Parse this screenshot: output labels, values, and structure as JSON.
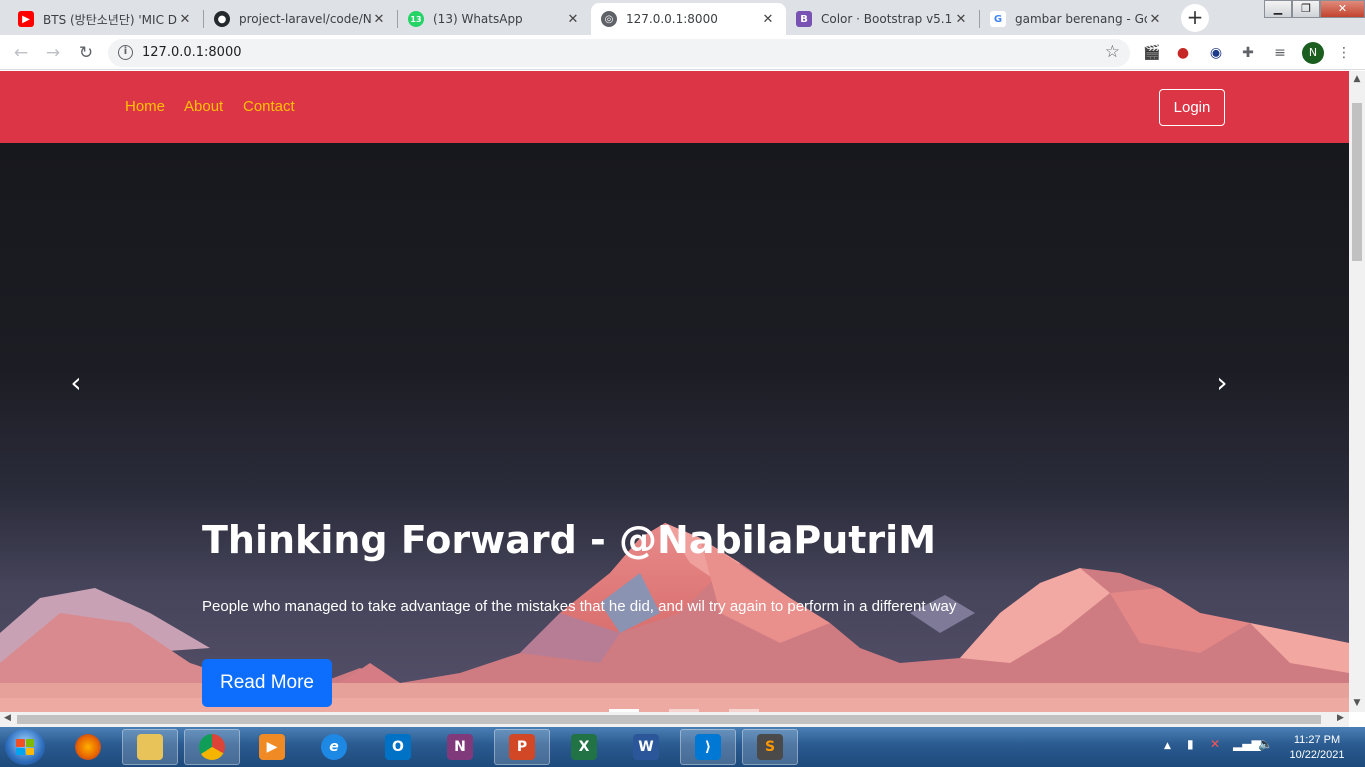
{
  "browser": {
    "tabs": [
      {
        "title": "BTS (방탄소년단) 'MIC D",
        "icon": "youtube-icon",
        "color": "#ff0000"
      },
      {
        "title": "project-laravel/code/Nal",
        "icon": "github-icon",
        "color": "#24292e"
      },
      {
        "title": "(13) WhatsApp",
        "icon": "whatsapp-icon",
        "color": "#25d366",
        "badge": "13"
      },
      {
        "title": "127.0.0.1:8000",
        "icon": "globe-icon",
        "color": "#5f6368",
        "active": true
      },
      {
        "title": "Color · Bootstrap v5.1",
        "icon": "bootstrap-icon",
        "color": "#7952b3",
        "letter": "B"
      },
      {
        "title": "gambar berenang - Goo",
        "icon": "google-icon",
        "color": "#4285f4",
        "letter": "G"
      }
    ],
    "new_tab": "+",
    "url": "127.0.0.1:8000",
    "profile_initial": "N"
  },
  "navbar": {
    "links": [
      "Home",
      "About",
      "Contact"
    ],
    "login_label": "Login",
    "bg_color": "#dc3545",
    "link_color": "#ffc107"
  },
  "carousel": {
    "title": "Thinking Forward - @NabilaPutriM",
    "text": "People who managed to take advantage of the mistakes that he did, and wil try again to perform in a different way",
    "button_label": "Read More",
    "prev_glyph": "‹",
    "next_glyph": "›",
    "slide_count": 3,
    "active_slide": 1
  },
  "taskbar": {
    "apps": [
      {
        "name": "firefox",
        "icon": "firefox-icon",
        "color": "#e66000",
        "letter": ""
      },
      {
        "name": "file-explorer",
        "icon": "folder-icon",
        "color": "#e8c35a",
        "letter": ""
      },
      {
        "name": "chrome",
        "icon": "chrome-icon",
        "color": "#db4437",
        "letter": ""
      },
      {
        "name": "media-player",
        "icon": "media-player-icon",
        "color": "#f08a24",
        "letter": "▶"
      },
      {
        "name": "internet-explorer",
        "icon": "ie-icon",
        "color": "#1e88e5",
        "letter": "e"
      },
      {
        "name": "outlook",
        "icon": "outlook-icon",
        "color": "#0072c6",
        "letter": "O"
      },
      {
        "name": "onenote",
        "icon": "onenote-icon",
        "color": "#80397b",
        "letter": "N"
      },
      {
        "name": "powerpoint",
        "icon": "powerpoint-icon",
        "color": "#d24726",
        "letter": "P"
      },
      {
        "name": "excel",
        "icon": "excel-icon",
        "color": "#217346",
        "letter": "X"
      },
      {
        "name": "word",
        "icon": "word-icon",
        "color": "#2b579a",
        "letter": "W"
      },
      {
        "name": "vscode",
        "icon": "vscode-icon",
        "color": "#0078d4",
        "letter": "⟩"
      },
      {
        "name": "sublime-text",
        "icon": "sublime-icon",
        "color": "#ff9800",
        "letter": "S"
      }
    ],
    "time": "11:27 PM",
    "date": "10/22/2021"
  }
}
